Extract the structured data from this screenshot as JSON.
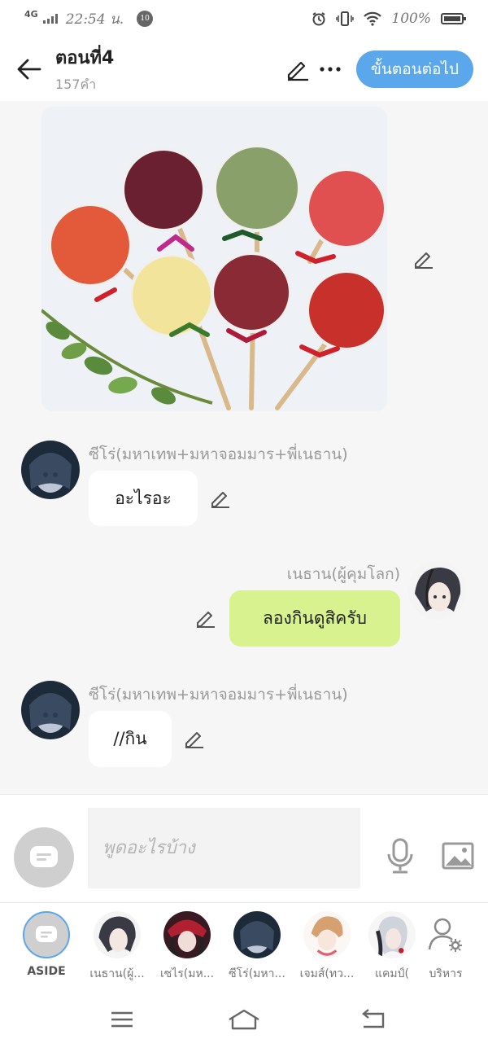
{
  "status_bar": {
    "network": "4G",
    "time": "22:54 น.",
    "notification_count": "10",
    "battery": "100%"
  },
  "header": {
    "title": "ตอนที่4",
    "word_count": "157คำ",
    "next_button": "ขั้นตอนต่อไป"
  },
  "messages": [
    {
      "type": "image",
      "alt": "lollipops photo"
    },
    {
      "sender": "ซีโร่(มหาเทพ+มหาจอมมาร+พี่เนธาน)",
      "text": "อะไรอะ",
      "side": "left"
    },
    {
      "sender": "เนธาน(ผู้คุมโลก)",
      "text": "ลองกินดูสิครับ",
      "side": "right"
    },
    {
      "sender": "ซีโร่(มหาเทพ+มหาจอมมาร+พี่เนธาน)",
      "text": "//กิน",
      "side": "left"
    }
  ],
  "composer": {
    "placeholder": "พูดอะไรบ้าง"
  },
  "characters": [
    {
      "name": "ASIDE"
    },
    {
      "name": "เนธาน(ผู้..."
    },
    {
      "name": "เซไร(มห..."
    },
    {
      "name": "ซีโร่(มหา..."
    },
    {
      "name": "เจมส์(ทว..."
    },
    {
      "name": "แคมป์("
    },
    {
      "name": "บริหาร"
    }
  ],
  "colors": {
    "accent": "#5aa7ec",
    "outgoing_bubble": "#d7f28f",
    "background": "#f6f6f6"
  }
}
